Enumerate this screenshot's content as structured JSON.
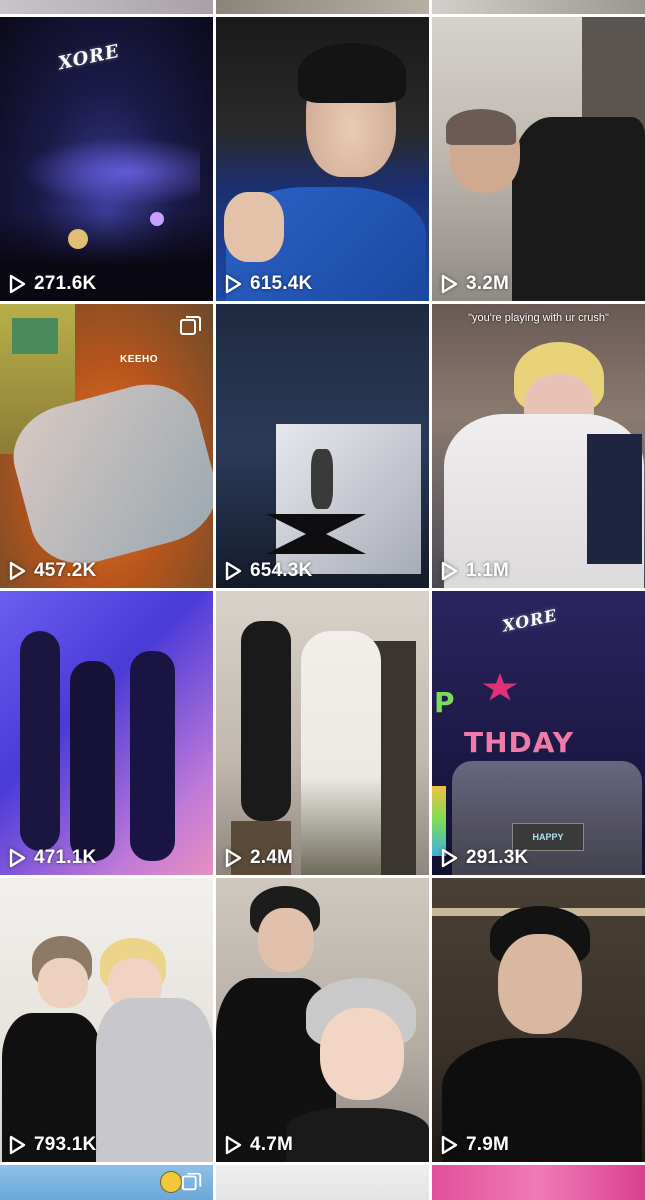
{
  "grid": {
    "tiles": [
      {
        "id": "r1c1",
        "views": "271.6K",
        "carousel": false
      },
      {
        "id": "r1c2",
        "views": "615.4K",
        "carousel": false
      },
      {
        "id": "r1c3",
        "views": "3.2M",
        "carousel": false
      },
      {
        "id": "r2c1",
        "views": "457.2K",
        "carousel": true
      },
      {
        "id": "r2c2",
        "views": "654.3K",
        "carousel": false
      },
      {
        "id": "r2c3",
        "views": "1.1M",
        "carousel": false
      },
      {
        "id": "r3c1",
        "views": "471.1K",
        "carousel": false
      },
      {
        "id": "r3c2",
        "views": "2.4M",
        "carousel": false
      },
      {
        "id": "r3c3",
        "views": "291.3K",
        "carousel": false
      },
      {
        "id": "r4c1",
        "views": "793.1K",
        "carousel": false
      },
      {
        "id": "r4c2",
        "views": "4.7M",
        "carousel": false
      },
      {
        "id": "r4c3",
        "views": "7.9M",
        "carousel": false
      }
    ],
    "overlays": {
      "r2c1_tag": "KEEHO",
      "r2c3_caption": "\"you're playing with ur crush\"",
      "r3c3_bday": "THDAY",
      "r3c3_bday_p": "P",
      "r3c3_cake": "HAPPY"
    }
  },
  "colors": {
    "view_text": "#ffffff",
    "background": "#ffffff"
  }
}
